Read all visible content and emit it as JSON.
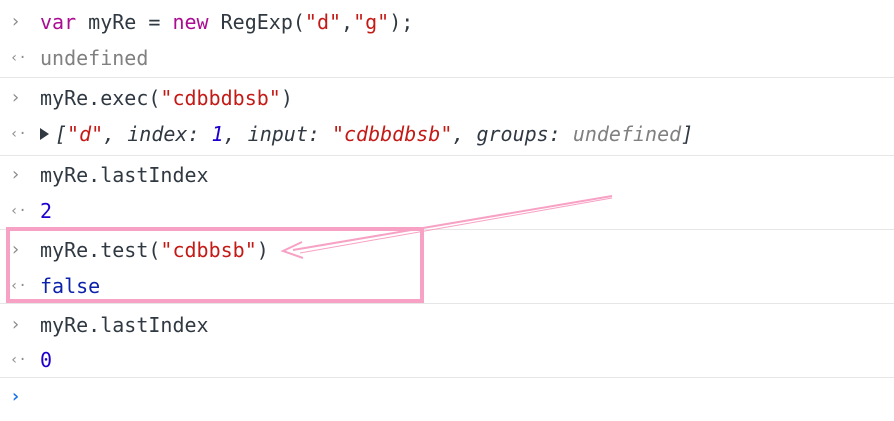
{
  "console": {
    "entries": [
      {
        "input_parts": [
          {
            "text": "var",
            "style": "kw"
          },
          {
            "text": " myRe = ",
            "style": "plain"
          },
          {
            "text": "new",
            "style": "kw"
          },
          {
            "text": " RegExp(",
            "style": "plain"
          },
          {
            "text": "\"d\"",
            "style": "str"
          },
          {
            "text": ",",
            "style": "plain"
          },
          {
            "text": "\"g\"",
            "style": "str"
          },
          {
            "text": ");",
            "style": "plain"
          }
        ],
        "output": "undefined",
        "output_style": "undef"
      },
      {
        "input_parts": [
          {
            "text": "myRe.exec(",
            "style": "plain"
          },
          {
            "text": "\"cdbbdbsb\"",
            "style": "str"
          },
          {
            "text": ")",
            "style": "plain"
          }
        ],
        "output_parts": [
          {
            "text": "[",
            "style": "obj"
          },
          {
            "text": "\"d\"",
            "style": "str"
          },
          {
            "text": ", index: ",
            "style": "obj"
          },
          {
            "text": "1",
            "style": "num"
          },
          {
            "text": ", input: ",
            "style": "obj"
          },
          {
            "text": "\"cdbbdbsb\"",
            "style": "str"
          },
          {
            "text": ", groups: ",
            "style": "obj"
          },
          {
            "text": "undefined",
            "style": "undef"
          },
          {
            "text": "]",
            "style": "obj"
          }
        ]
      },
      {
        "input": "myRe.lastIndex",
        "output": "2",
        "output_style": "num"
      },
      {
        "input_parts": [
          {
            "text": "myRe.test(",
            "style": "plain"
          },
          {
            "text": "\"cdbbsb\"",
            "style": "str"
          },
          {
            "text": ")",
            "style": "plain"
          }
        ],
        "output": "false",
        "output_style": "bool"
      },
      {
        "input": "myRe.lastIndex",
        "output": "0",
        "output_style": "num"
      }
    ]
  },
  "icons": {
    "input_prompt": "chevron-right-icon",
    "output_prompt": "return-arrow-icon",
    "active_prompt": "chevron-right-icon"
  },
  "glyphs": {
    "input": "›",
    "output": "‹·",
    "active": "›"
  },
  "colors": {
    "keyword": "#aa0d91",
    "string": "#c41a16",
    "number": "#1c00cf",
    "boolean": "#0d22aa",
    "undefined": "#808080",
    "highlight_border": "#f7a1c4",
    "active_prompt": "#1a73e8"
  }
}
